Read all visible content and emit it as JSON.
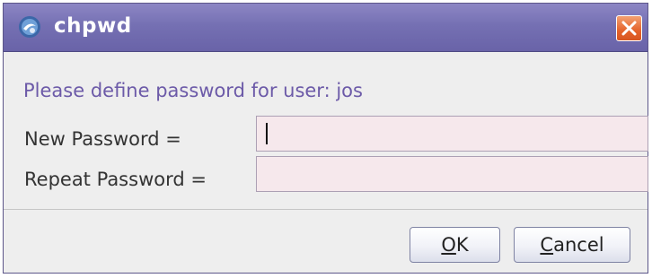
{
  "window": {
    "title": "chpwd",
    "app_icon": "java-app-icon",
    "close_icon": "close-icon",
    "colors": {
      "titlebar": "#7570b3",
      "close": "#e5632b",
      "prompt": "#6c5aa8",
      "field_bg": "#f6e8ec"
    }
  },
  "prompt": "Please define password for user: jos",
  "fields": [
    {
      "label": "New Password =",
      "value": ""
    },
    {
      "label": "Repeat Password =",
      "value": ""
    }
  ],
  "buttons": {
    "ok": {
      "mnemonic": "O",
      "rest": "K"
    },
    "cancel": {
      "mnemonic": "C",
      "rest": "ancel"
    }
  }
}
